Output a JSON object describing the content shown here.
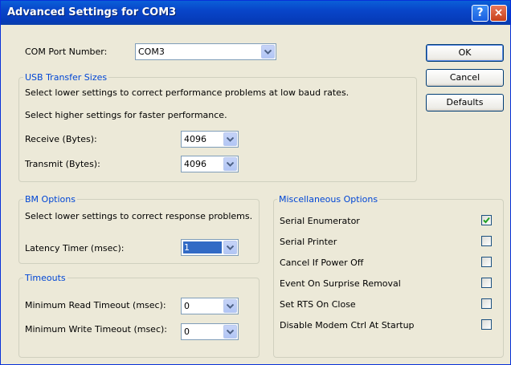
{
  "window": {
    "title": "Advanced Settings for COM3"
  },
  "titlebar": {
    "help_glyph": "?",
    "close_glyph": "×"
  },
  "com_port": {
    "label": "COM Port Number:",
    "value": "COM3"
  },
  "usb": {
    "legend": "USB Transfer Sizes",
    "desc1": "Select lower settings to correct performance problems at low baud rates.",
    "desc2": "Select higher settings for faster performance.",
    "receive_label": "Receive (Bytes):",
    "receive_value": "4096",
    "transmit_label": "Transmit (Bytes):",
    "transmit_value": "4096"
  },
  "bm": {
    "legend": "BM Options",
    "desc": "Select lower settings to correct response problems.",
    "latency_label": "Latency Timer (msec):",
    "latency_value": "1"
  },
  "timeouts": {
    "legend": "Timeouts",
    "read_label": "Minimum Read Timeout (msec):",
    "read_value": "0",
    "write_label": "Minimum Write Timeout (msec):",
    "write_value": "0"
  },
  "misc": {
    "legend": "Miscellaneous Options",
    "options": [
      {
        "label": "Serial Enumerator",
        "checked": true
      },
      {
        "label": "Serial Printer",
        "checked": false
      },
      {
        "label": "Cancel If Power Off",
        "checked": false
      },
      {
        "label": "Event On Surprise Removal",
        "checked": false
      },
      {
        "label": "Set RTS On Close",
        "checked": false
      },
      {
        "label": "Disable Modem Ctrl At Startup",
        "checked": false
      }
    ]
  },
  "buttons": {
    "ok": "OK",
    "cancel": "Cancel",
    "defaults": "Defaults"
  },
  "colors": {
    "titlebar": "#0845c9",
    "group_legend": "#0046d5",
    "selection": "#316ac5",
    "check": "#21a121"
  }
}
